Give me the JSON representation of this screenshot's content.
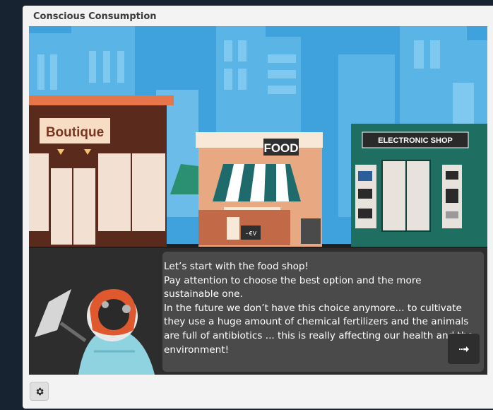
{
  "window": {
    "title": "Conscious Consumption"
  },
  "shops": {
    "boutique_sign": "Boutique",
    "food_sign": "FOOD",
    "electronic_sign": "ELECTRONIC SHOP",
    "price_tag": "-€V"
  },
  "dialog": {
    "lines": [
      "Let’s start with the food shop!",
      "Pay attention to choose the best option and the more sustainable one.",
      "In the future we don’t have this choice anymore... to cultivate they use a huge amount of chemical fertilizers and the animals are full of antibiotics ... this is really affecting our health and the environment!"
    ]
  },
  "icons": {
    "next": "arrow-right-icon",
    "settings": "gear-icon"
  },
  "colors": {
    "sky": "#3fa2dd",
    "boutique": "#5a2a1c",
    "food_awning": "#1f6b6b",
    "electronic": "#1f6e62",
    "dialog_bg": "#4a4a4a"
  }
}
